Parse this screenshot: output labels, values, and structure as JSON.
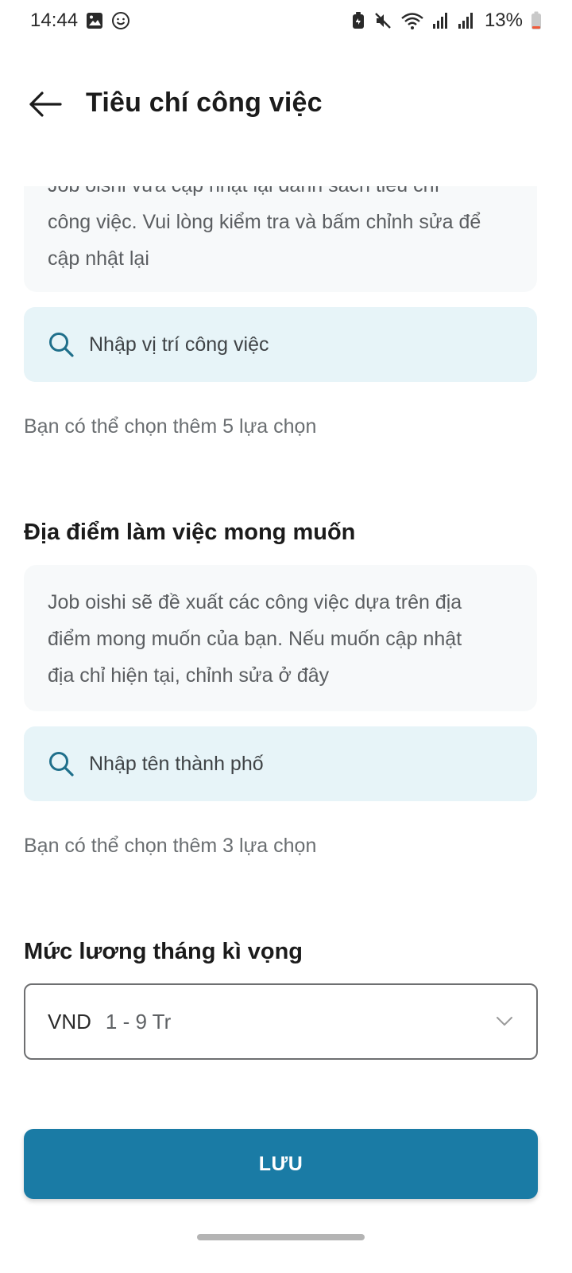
{
  "status_bar": {
    "time": "14:44",
    "battery": "13%",
    "left_icons": [
      "gallery-icon",
      "face-icon"
    ],
    "right_icons": [
      "battery-saver-icon",
      "mute-icon",
      "wifi-icon",
      "signal-icon",
      "signal-icon"
    ],
    "battery_color": "#f05a3a"
  },
  "header": {
    "title": "Tiêu chí công việc",
    "back_icon": "arrow-left-icon"
  },
  "job_section": {
    "info_lines": [
      "Job oishi vừa cập nhật lại danh sách tiêu chí",
      "công việc. Vui lòng kiểm tra và bấm chỉnh sửa để",
      "cập nhật lại"
    ],
    "search_placeholder": "Nhập vị trí công việc",
    "hint": "Bạn có thể chọn thêm 5 lựa chọn"
  },
  "location_section": {
    "title": "Địa điểm làm việc mong muốn",
    "info_lines": [
      "Job oishi sẽ đề xuất các công việc dựa trên địa",
      "điểm mong muốn của bạn. Nếu muốn cập nhật",
      "địa chỉ hiện tại, chỉnh sửa ở đây"
    ],
    "search_placeholder": "Nhập tên thành phố",
    "hint": "Bạn có thể chọn thêm 3 lựa chọn"
  },
  "salary_section": {
    "title": "Mức lương tháng kì vọng",
    "currency": "VND",
    "selected_range": "1 - 9 Tr"
  },
  "save_button": {
    "label": "LƯU"
  },
  "colors": {
    "primary": "#1a7ba5",
    "search_bg": "#e7f4f8",
    "info_bg": "#f7f9fa",
    "search_icon": "#1f6f8b"
  }
}
